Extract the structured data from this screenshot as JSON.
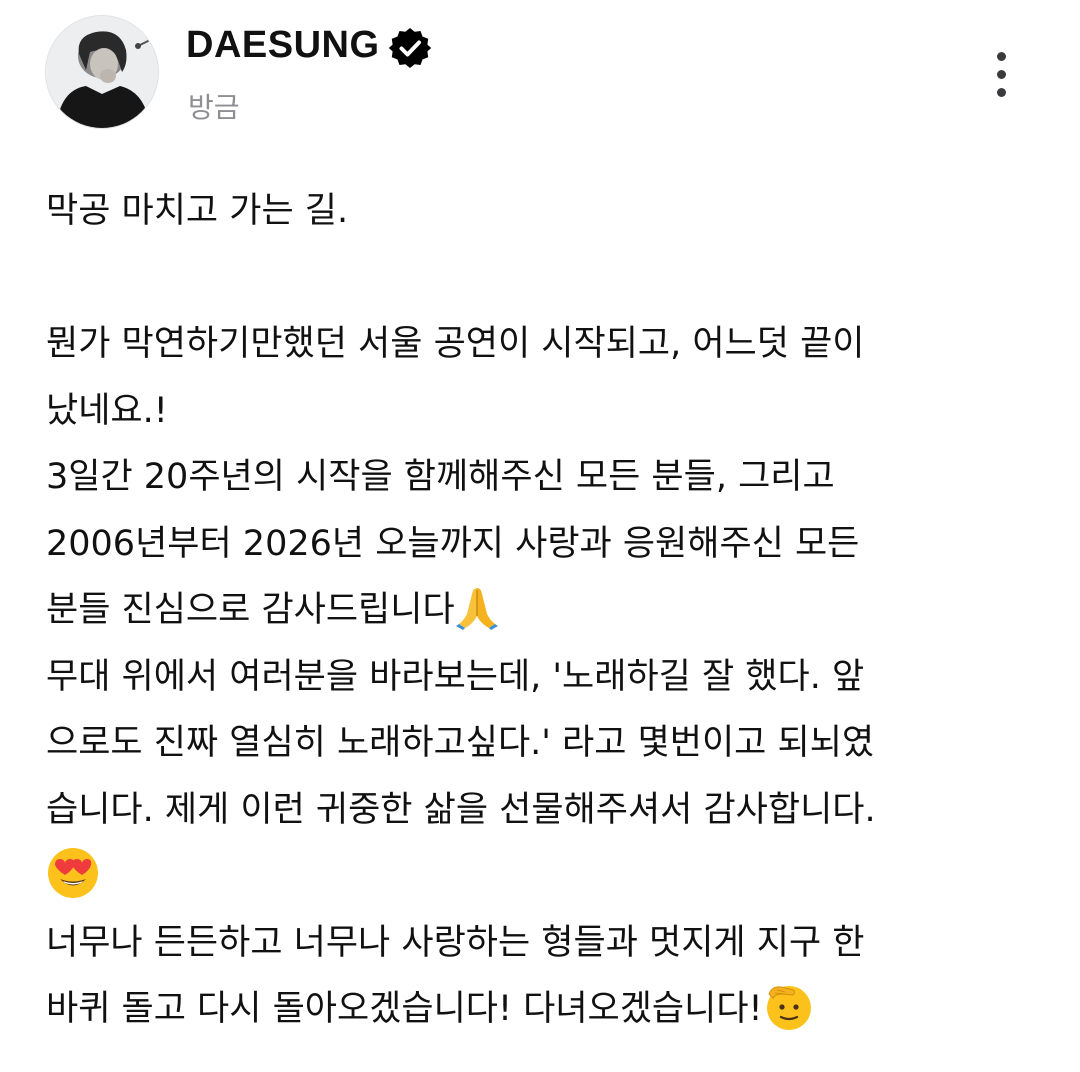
{
  "post": {
    "author": {
      "name": "DAESUNG",
      "verified": true,
      "badge_icon": "verified-badge-icon",
      "avatar_icon": "profile-photo-avatar"
    },
    "timestamp": "방금",
    "more_icon": "more-vertical-icon",
    "body": {
      "lines": [
        "막공 마치고 가는 길.",
        "",
        "뭔가 막연하기만했던 서울 공연이 시작되고, 어느덧 끝이",
        "났네요.!",
        "3일간 20주년의 시작을 함께해주신 모든 분들, 그리고",
        "2006년부터 2026년 오늘까지 사랑과 응원해주신 모든",
        "분들 진심으로 감사드립니다",
        "무대 위에서 여러분을 바라보는데, '노래하길 잘 했다. 앞",
        "으로도 진짜 열심히 노래하고싶다.' 라고 몇번이고 되뇌였",
        "습니다. 제게 이런 귀중한 삶을 선물해주셔서 감사합니다.",
        "",
        "너무나 든든하고 너무나 사랑하는 형들과 멋지게 지구 한",
        "바퀴 돌고 다시 돌아오겠습니다! 다녀오겠습니다!"
      ],
      "emojis": {
        "pray": "folded-hands-emoji",
        "heart_eyes": "heart-eyes-emoji",
        "salute": "saluting-face-emoji"
      }
    }
  },
  "colors": {
    "background": "#ffffff",
    "text": "#111111",
    "muted": "#8e8e93",
    "icon": "#3a3a3c"
  }
}
